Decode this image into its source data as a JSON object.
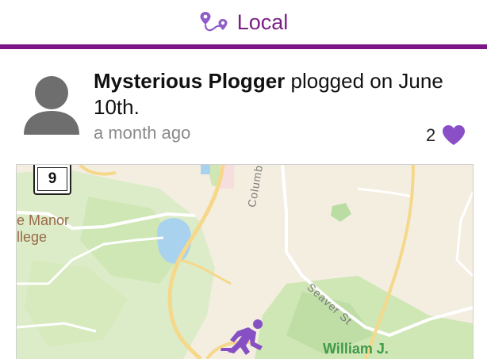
{
  "header": {
    "title": "Local",
    "icon": "route-pin-icon",
    "accent": "#7a1487"
  },
  "post": {
    "user_name": "Mysterious Plogger",
    "action_text": " plogged on June 10th.",
    "time_ago": "a month ago",
    "like_count": "2",
    "like_icon": "heart-icon",
    "avatar_icon": "user-avatar-icon"
  },
  "map": {
    "route_shield": "9",
    "labels": {
      "manor": "e Manor\nllege",
      "columbus": "Columbus A",
      "seaver": "Seaver St",
      "park": "William J."
    },
    "marker_icon": "runner-icon"
  }
}
